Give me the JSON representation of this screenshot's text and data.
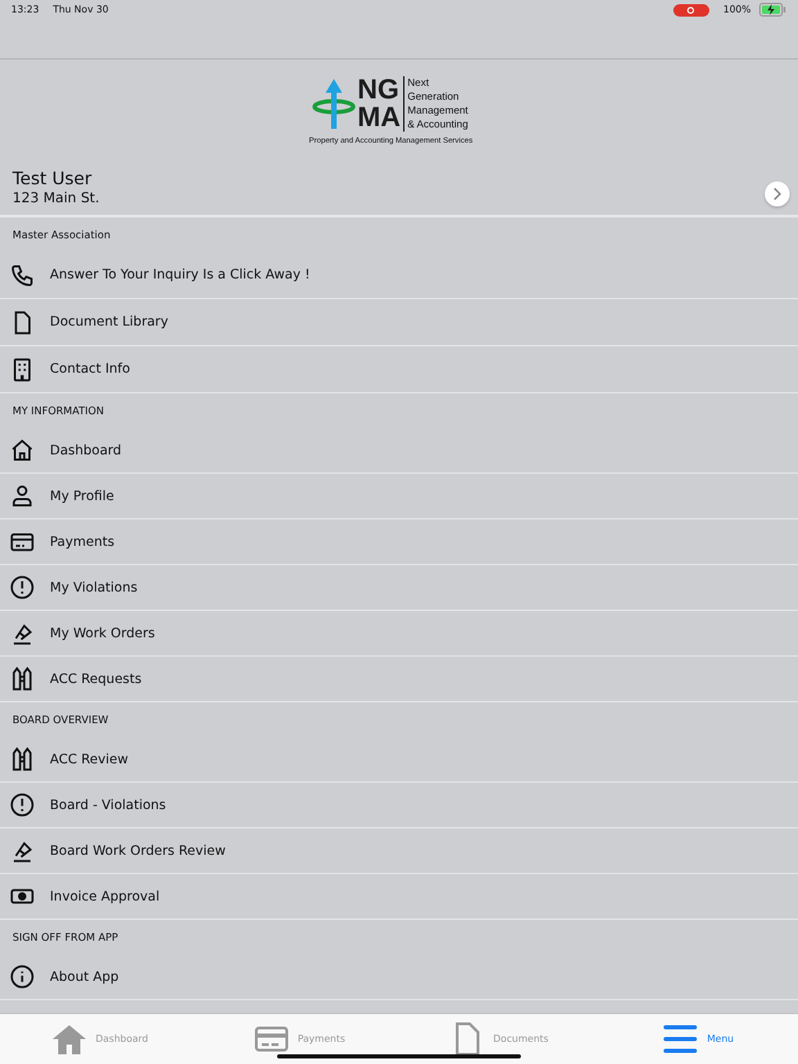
{
  "status_bar": {
    "time": "13:23",
    "date": "Thu Nov 30",
    "recording": true,
    "battery": "100%",
    "charging": true
  },
  "logo": {
    "letters": [
      "NG",
      "MA"
    ],
    "name_lines": [
      "Next",
      "Generation",
      "Management",
      "& Accounting"
    ],
    "tagline": "Property and Accounting Management Services"
  },
  "user": {
    "name": "Test User",
    "address": "123 Main St."
  },
  "sections": [
    {
      "title": "Master Association",
      "items": [
        {
          "label": "Answer To Your Inquiry Is a Click Away !"
        },
        {
          "label": "Document Library"
        },
        {
          "label": "Contact Info"
        }
      ]
    },
    {
      "title": "MY INFORMATION",
      "items": [
        {
          "label": "Dashboard"
        },
        {
          "label": "My Profile"
        },
        {
          "label": "Payments"
        },
        {
          "label": "My Violations"
        },
        {
          "label": "My Work Orders"
        },
        {
          "label": "ACC Requests"
        }
      ]
    },
    {
      "title": "BOARD OVERVIEW",
      "items": [
        {
          "label": "ACC Review"
        },
        {
          "label": "Board - Violations"
        },
        {
          "label": "Board Work Orders Review"
        },
        {
          "label": "Invoice Approval"
        }
      ]
    },
    {
      "title": "SIGN OFF FROM APP",
      "items": [
        {
          "label": "About App"
        }
      ]
    }
  ],
  "tab_bar": [
    {
      "label": "Dashboard",
      "selected": false
    },
    {
      "label": "Payments",
      "selected": false
    },
    {
      "label": "Documents",
      "selected": false
    },
    {
      "label": "Menu",
      "selected": true
    }
  ]
}
